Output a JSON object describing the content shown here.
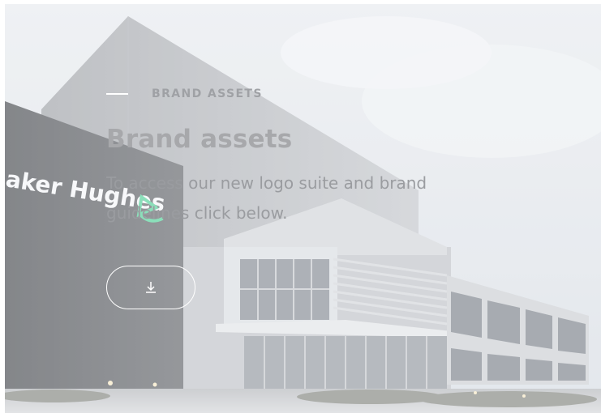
{
  "hero": {
    "eyebrow": "BRAND ASSETS",
    "title": "Brand assets",
    "description": "To access our new logo suite and brand guidelines click below.",
    "building_sign": "aker Hughes",
    "download_icon": "download-icon"
  },
  "colors": {
    "accent_line": "#ffffff",
    "text_muted": "#9fa1a5",
    "logo_green": "#5fd3a0"
  }
}
